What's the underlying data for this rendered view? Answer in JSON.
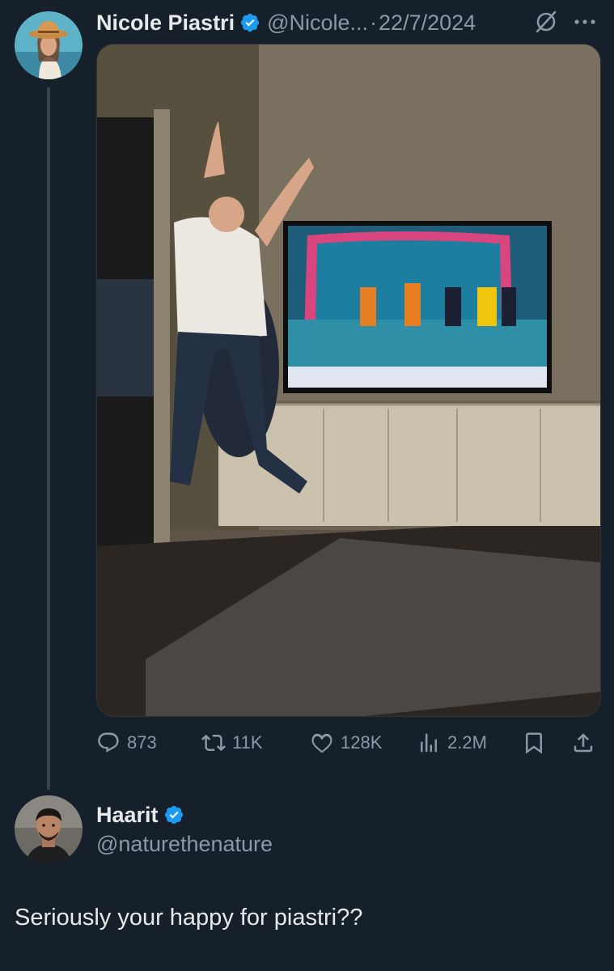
{
  "colors": {
    "background": "#15202b",
    "text_primary": "#e7e9ea",
    "text_secondary": "#8b98a5",
    "verified_blue": "#1d9bf0",
    "thread_line": "#38444d"
  },
  "tweet": {
    "author_name": "Nicole Piastri",
    "author_handle": "@Nicole...",
    "separator": "·",
    "date": "22/7/2024",
    "verified": true,
    "media_alt": "photo",
    "icons": {
      "verified": "verified-badge-icon",
      "grok": "grok-icon",
      "more": "more-options-icon"
    },
    "stats": {
      "replies": "873",
      "retweets": "11K",
      "likes": "128K",
      "views": "2.2M"
    }
  },
  "reply": {
    "author_name": "Haarit",
    "author_handle": "@naturethenature",
    "verified": true,
    "text": "Seriously your happy for piastri??"
  }
}
